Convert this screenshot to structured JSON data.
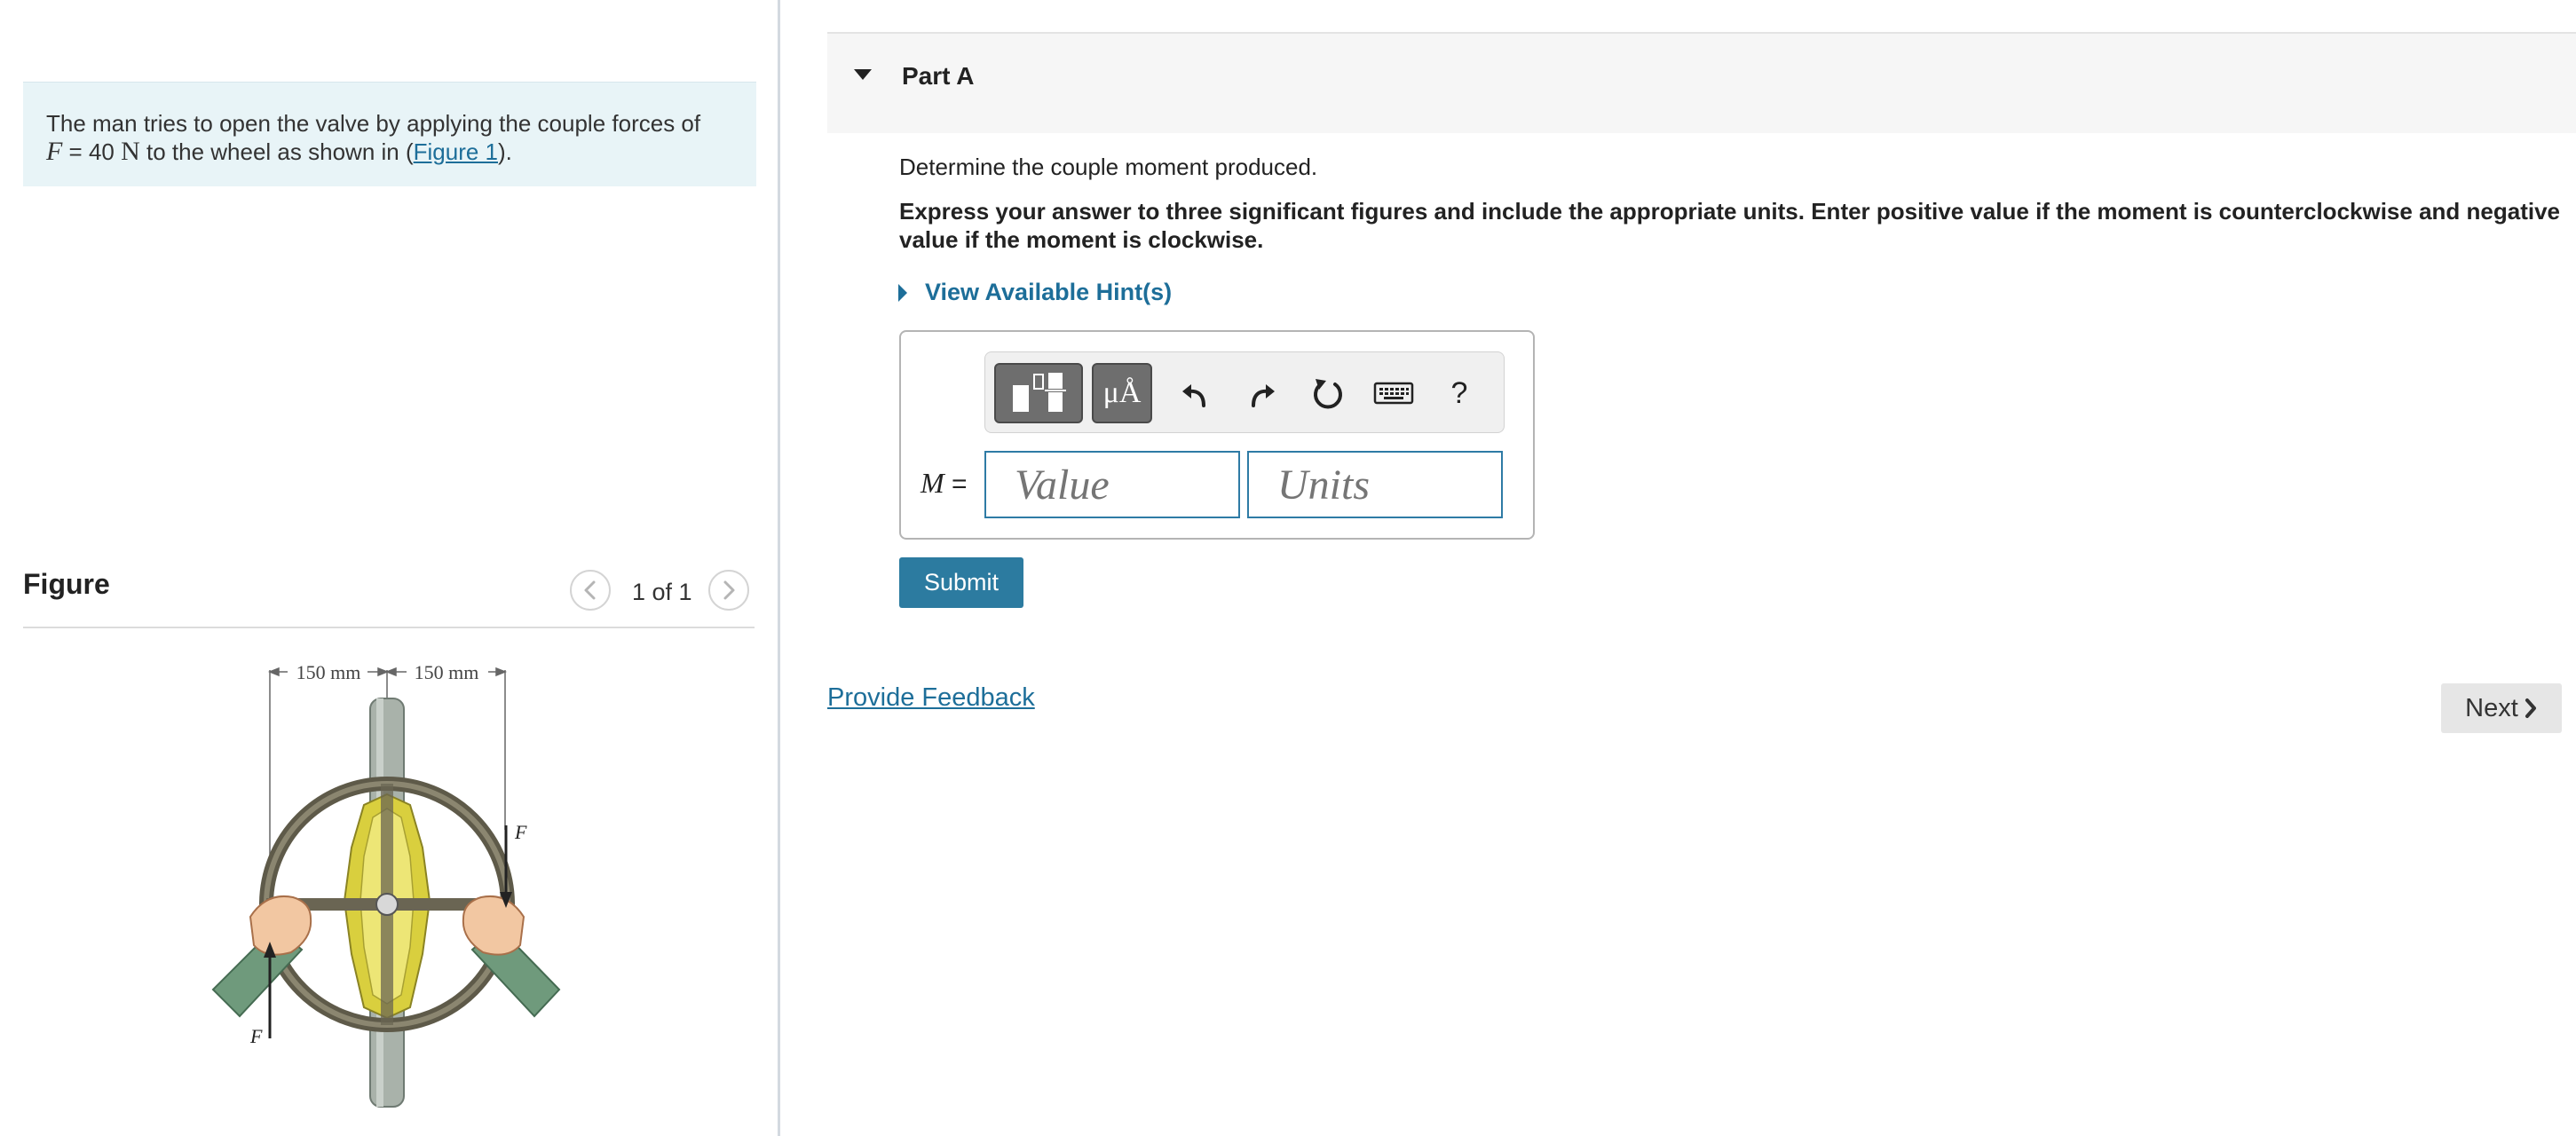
{
  "problem": {
    "text_before": "The man tries to open the valve by applying the couple forces of",
    "var": "F",
    "equals": " = 40 ",
    "unit": "N",
    "text_after": " to the wheel as shown in (",
    "figure_link": "Figure 1",
    "text_end": ")."
  },
  "figure": {
    "title": "Figure",
    "counter": "1 of 1",
    "dim_left": "150 mm",
    "dim_right": "150 mm",
    "force_top": "F",
    "force_bottom": "F"
  },
  "part": {
    "title": "Part A",
    "question": "Determine the couple moment produced.",
    "instructions": "Express your answer to three significant figures and include the appropriate units. Enter positive value if the moment is counterclockwise and negative value if the moment is clockwise.",
    "hints_label": "View Available Hint(s)"
  },
  "answer": {
    "var": "M",
    "equals": " =",
    "value_placeholder": "Value",
    "units_placeholder": "Units",
    "mu_label": "μÅ",
    "help_label": "?"
  },
  "buttons": {
    "submit": "Submit",
    "feedback": "Provide Feedback",
    "next": "Next"
  }
}
